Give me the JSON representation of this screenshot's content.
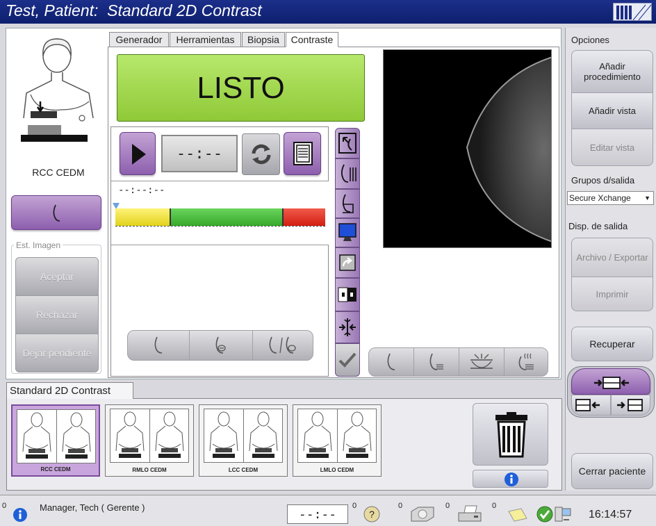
{
  "window": {
    "title": "Test, Patient:  Standard 2D Contrast"
  },
  "patient": {
    "view_label": "RCC CEDM"
  },
  "image_state": {
    "title": "Est. Imagen",
    "accept": "Aceptar",
    "reject": "Rechazar",
    "pending": "Dejar pendiente"
  },
  "tabs": [
    {
      "label": "Generador"
    },
    {
      "label": "Herramientas"
    },
    {
      "label": "Biopsia"
    },
    {
      "label": "Contraste"
    }
  ],
  "active_tab": "Contraste",
  "contrast": {
    "status": "LISTO",
    "status_color": "#9fd84a",
    "timer": "--:--",
    "time_readout": "--:--:--",
    "progress_colors": [
      "#f2e63a",
      "#4cc03f",
      "#e53b2c"
    ]
  },
  "options": {
    "title": "Opciones",
    "add_procedure": "Añadir procedimiento",
    "add_view": "Añadir vista",
    "edit_view": "Editar vista"
  },
  "output_groups": {
    "title": "Grupos d/salida",
    "selected": "Secure Xchange"
  },
  "output_devices": {
    "title": "Disp. de salida",
    "archive": "Archivo / Exportar",
    "print": "Imprimir"
  },
  "recover_label": "Recuperar",
  "close_patient_label": "Cerrar paciente",
  "procedure": {
    "name": "Standard 2D Contrast",
    "thumbnails": [
      {
        "label": "RCC CEDM",
        "selected": true
      },
      {
        "label": "RMLO CEDM",
        "selected": false
      },
      {
        "label": "LCC CEDM",
        "selected": false
      },
      {
        "label": "LMLO CEDM",
        "selected": false
      }
    ]
  },
  "statusbar": {
    "alert_count": "0",
    "user": "Manager, Tech ( Gerente )",
    "timer": "--:--",
    "help_count": "0",
    "drive_count": "0",
    "printer_count": "0",
    "queue_count": "0",
    "clock": "16:14:57"
  },
  "colors": {
    "title_bar": "#142680",
    "accent_purple": "#9b6fbf",
    "status_ready": "#9fd84a"
  }
}
